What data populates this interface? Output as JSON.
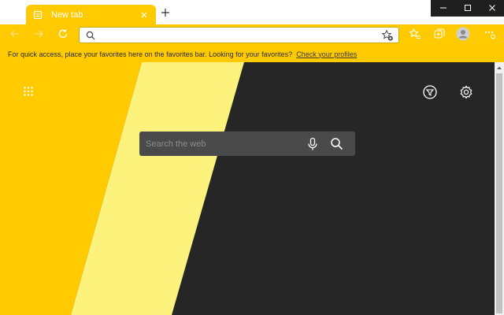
{
  "tab": {
    "title": "New tab",
    "icon": "page-icon",
    "close_icon": "close-icon"
  },
  "new_tab_icon": "plus-icon",
  "window_controls": [
    "minimize-icon",
    "maximize-icon",
    "close-icon"
  ],
  "toolbar": {
    "back_icon": "arrow-left-icon",
    "forward_icon": "arrow-right-icon",
    "refresh_icon": "refresh-icon",
    "address": {
      "value": "",
      "placeholder": "",
      "search_icon": "search-icon",
      "favorite_icon": "star-add-icon"
    },
    "favorites_icon": "favorites-icon",
    "collections_icon": "collections-icon",
    "profile_icon": "avatar-icon",
    "menu_icon": "more-icon"
  },
  "favorites_bar": {
    "message": "For quick access, place your favorites here on the favorites bar. Looking for your favorites?",
    "link": "Check your profiles"
  },
  "newtab_page": {
    "apps_icon": "apps-grid-icon",
    "filter_icon": "filter-icon",
    "settings_icon": "gear-icon",
    "search": {
      "placeholder": "Search the web",
      "value": "",
      "mic_icon": "microphone-icon",
      "submit_icon": "search-icon"
    }
  },
  "colors": {
    "theme_yellow": "#ffcb00",
    "light_yellow": "#fdf27c",
    "dark_bg": "#262626",
    "search_box": "#4a4a4a"
  }
}
